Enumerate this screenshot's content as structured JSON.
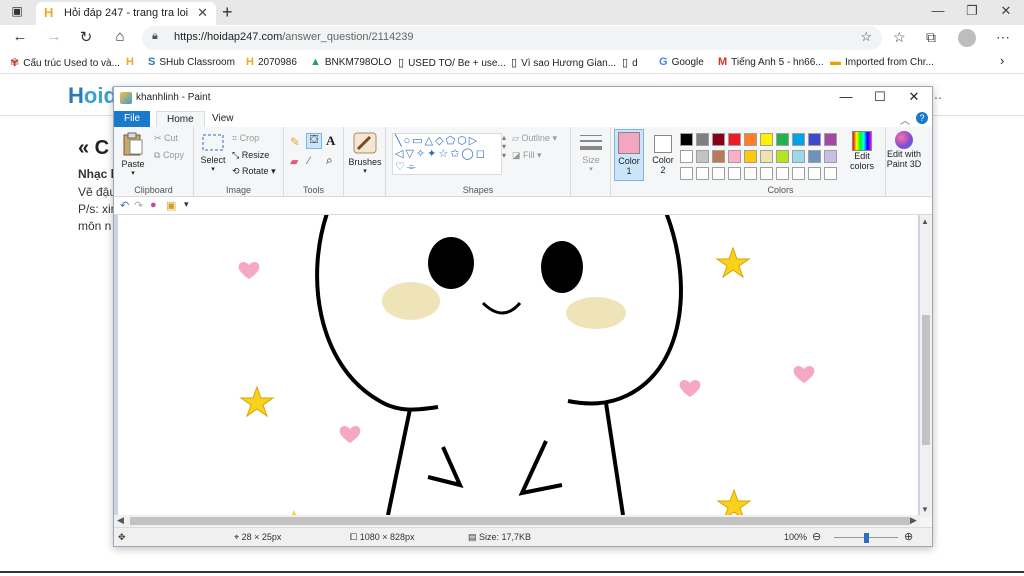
{
  "browser": {
    "tab_title": "Hỏi đáp 247 - trang tra loi",
    "tab_favicon": "H",
    "url_host": "https://hoidap247.com",
    "url_path": "/answer_question/2114239"
  },
  "bookmarks": [
    {
      "label": "Cấu trúc Used to và...",
      "icon": "puzzle-icon"
    },
    {
      "label": "",
      "icon": "hoidap-icon"
    },
    {
      "label": "SHub Classroom",
      "icon": "shub-icon"
    },
    {
      "label": "2070986",
      "icon": "hoidap-icon"
    },
    {
      "label": "BNKM798OLO",
      "icon": "drive-icon"
    },
    {
      "label": "USED TO/ Be + use...",
      "icon": "page-icon"
    },
    {
      "label": "Vì sao Hương Gian...",
      "icon": "page-icon"
    },
    {
      "label": "d",
      "icon": "page-icon"
    },
    {
      "label": "Google",
      "icon": "google-icon"
    },
    {
      "label": "Tiếng Anh 5 - hn66...",
      "icon": "gmail-icon"
    },
    {
      "label": "Imported from Chr...",
      "icon": "folder-icon"
    }
  ],
  "page": {
    "logo_h": "H",
    "logo_rest": "oid",
    "heading": "« C",
    "line1": "Nhạc l",
    "line2": "Vẽ đậu",
    "line3": "P/s: xin",
    "line4": "môn n"
  },
  "paint": {
    "title": "khanhlinh - Paint",
    "tabs": {
      "file": "File",
      "home": "Home",
      "view": "View"
    },
    "clipboard": {
      "paste": "Paste",
      "cut": "Cut",
      "copy": "Copy",
      "label": "Clipboard"
    },
    "image": {
      "select": "Select",
      "crop": "Crop",
      "resize": "Resize",
      "rotate": "Rotate",
      "label": "Image"
    },
    "tools": {
      "label": "Tools"
    },
    "brushes": {
      "label": "Brushes"
    },
    "shapes": {
      "outline": "Outline",
      "fill": "Fill",
      "label": "Shapes"
    },
    "size": {
      "label": "Size"
    },
    "color1": {
      "label": "Color 1"
    },
    "color2": {
      "label": "Color 2"
    },
    "colors": {
      "edit": "Edit colors",
      "label": "Colors"
    },
    "paint3d": {
      "label": "Edit with Paint 3D"
    },
    "status": {
      "cursor_pos": "28 × 25px",
      "image_dims": "1080 × 828px",
      "file_size": "Size: 17,7KB",
      "zoom": "100%"
    },
    "palette_row1": [
      "#000000",
      "#7f7f7f",
      "#880015",
      "#ed1c24",
      "#ff7f27",
      "#fff200",
      "#22b14c",
      "#00a2e8",
      "#3f48cc",
      "#a349a4"
    ],
    "palette_row2": [
      "#ffffff",
      "#c3c3c3",
      "#b97a57",
      "#ffaec9",
      "#ffc90e",
      "#efe4b0",
      "#b5e61d",
      "#99d9ea",
      "#7092be",
      "#c8bfe7"
    ],
    "color1_value": "#f4a6c1",
    "color2_value": "#ffffff",
    "zoom_level": 0.5
  }
}
